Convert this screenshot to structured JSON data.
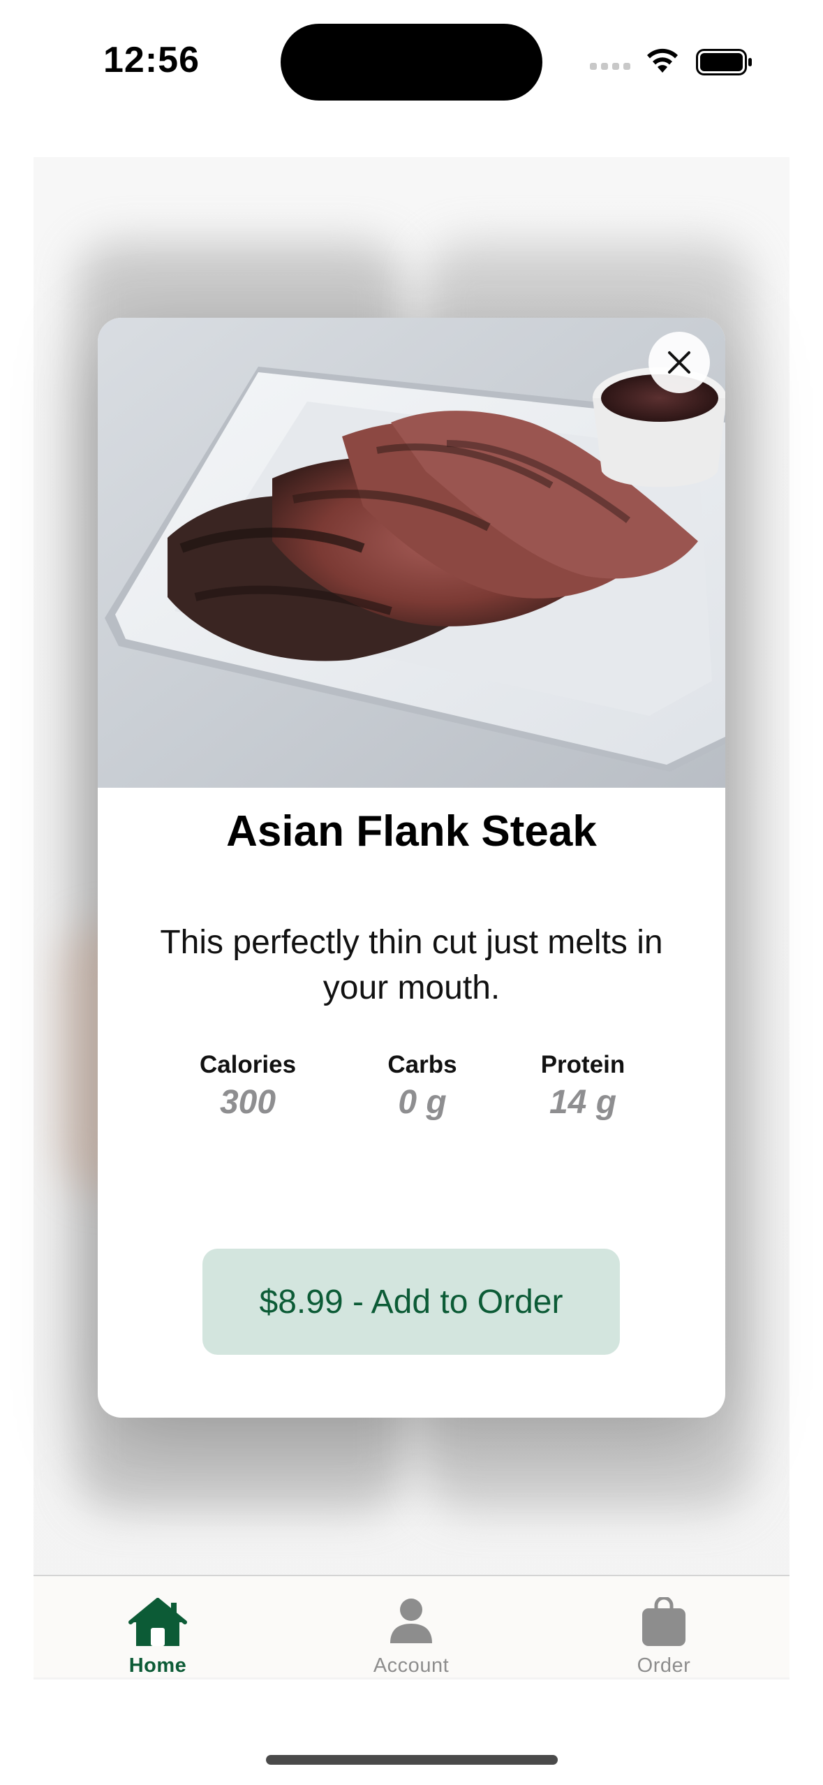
{
  "status_bar": {
    "time": "12:56"
  },
  "modal": {
    "title": "Asian Flank Steak",
    "description": "This perfectly thin cut just melts in your mouth.",
    "photo_alt": "sliced grilled flank steak on a white square plate with dipping sauce",
    "nutrition": [
      {
        "label": "Calories",
        "value": "300"
      },
      {
        "label": "Carbs",
        "value": "0 g"
      },
      {
        "label": "Protein",
        "value": "14 g"
      }
    ],
    "add_button_label": "$8.99 - Add to Order"
  },
  "tab_bar": {
    "items": [
      {
        "label": "Home",
        "icon": "home-icon",
        "active": true
      },
      {
        "label": "Account",
        "icon": "person-icon",
        "active": false
      },
      {
        "label": "Order",
        "icon": "bag-icon",
        "active": false
      }
    ]
  },
  "colors": {
    "accent": "#0c5b36",
    "button_bg": "#d3e5de",
    "muted_text": "#8e8e90",
    "inactive_tab": "#8d8d8d"
  }
}
